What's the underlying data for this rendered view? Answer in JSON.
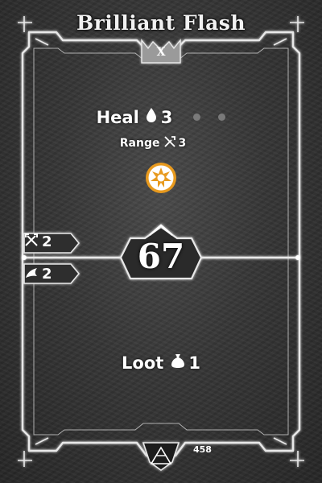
{
  "card": {
    "title": "Brilliant Flash",
    "level": "X",
    "initiative": "67",
    "card_number": "458"
  },
  "top_action": {
    "heal_label": "Heal",
    "heal_value": "3",
    "range_label": "Range",
    "range_value": "3",
    "element": "light-element-icon"
  },
  "bottom_action": {
    "loot_label": "Loot",
    "loot_value": "1"
  },
  "side_tags": [
    {
      "icon": "crossed-swords-icon",
      "value": "2"
    },
    {
      "icon": "wing-icon",
      "value": "2"
    }
  ],
  "colors": {
    "element_orange": "#e89a1e",
    "frame_glow": "#f0f0f0"
  }
}
